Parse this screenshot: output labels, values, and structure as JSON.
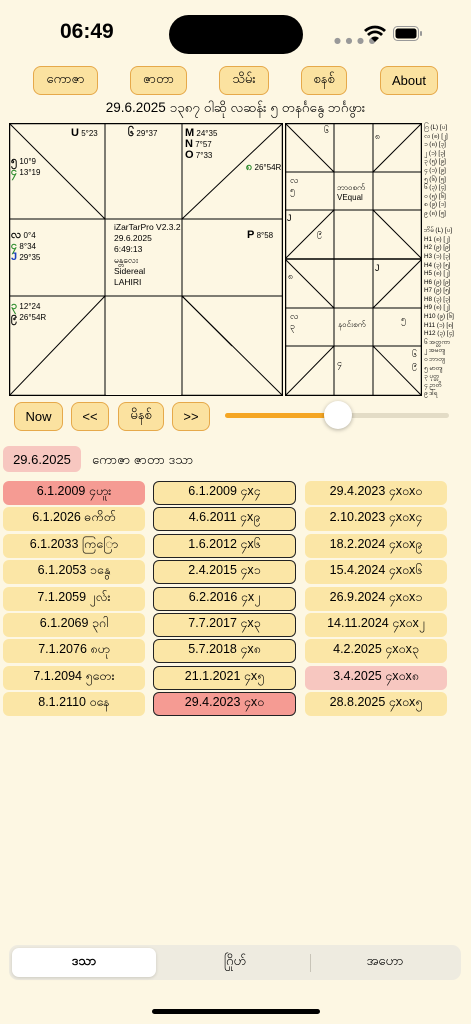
{
  "status_bar": {
    "time": "06:49"
  },
  "top_tabs": [
    "ကောဇာ",
    "ဇာတာ",
    "သိမ်း",
    "စနစ်",
    "About"
  ],
  "header_line": "29.6.2025  ၁၃၈၇ ဝါဆို  လဆန်း ၅ တနင်္ဂနွေ  ဘင်္ဂဖွား",
  "south_chart": {
    "cells": {
      "top_left": [
        {
          "sym": "U",
          "deg": "5°23"
        }
      ],
      "top_mid": [
        {
          "sym": "၆",
          "deg": "29°37"
        }
      ],
      "top_right": [
        {
          "sym": "M",
          "deg": "24°35"
        },
        {
          "sym": "N",
          "deg": "7°57"
        },
        {
          "sym": "O",
          "deg": "7°33"
        }
      ],
      "right_upper_tri": [
        {
          "sym": "၈",
          "deg": "26°54R"
        }
      ],
      "left_upper": [
        {
          "sym": "၅",
          "deg": "10°9"
        },
        {
          "sym": "၄",
          "deg": "13°19"
        }
      ],
      "left_mid": [
        {
          "sym": "လ",
          "deg": "0°4"
        },
        {
          "sym": "၄",
          "deg": "8°34"
        },
        {
          "sym": "J",
          "deg": "29°35"
        }
      ],
      "right_mid": [
        {
          "sym": "P",
          "deg": "8°58"
        }
      ],
      "left_lower": [
        {
          "sym": "၃",
          "deg": "12°24"
        },
        {
          "sym": "၉",
          "deg": "26°54R"
        }
      ]
    },
    "center_info": [
      "iZarTarPro V2.3.2",
      "29.6.2025",
      "6:49:13",
      "မန္တလေး",
      "Sidereal",
      "LAHIRI"
    ]
  },
  "grid_chart": {
    "cells": [
      "၆",
      "၈",
      "လ\n၅",
      "ဘာဝစက်\nVEqual",
      "J",
      "၉",
      "၈",
      "J",
      "လ\n၃",
      "နဝင်းစက်",
      "၅",
      "၄",
      "၆\n၉"
    ]
  },
  "side_list": [
    "ဂြ (L) [ပ]",
    "လ (၈) [၂]",
    "၁ (၈) [၃]",
    "၂ (၁) [၃]",
    "၃ (၅) [၉]",
    "၄ (၁) [၉]",
    "၅ (၆) [၅]",
    "၆ (၃) [၄]",
    "၀ (၅) [၆]",
    "၈ (၉) [၁]",
    "၉ (၈) [၅]",
    "",
    "ဘိမ် (L) [ပ]",
    "H1 (၈) [၂]",
    "H2 (၉) [၉]",
    "H3 (၁) [၃]",
    "H4 (၃) [၅]",
    "H5 (၈) [၂]",
    "H6 (၉) [၉]",
    "H7 (၉) [၅]",
    "H8 (၃) [၃]",
    "H9 (၈) [၂]",
    "H10 (၉) [၆]",
    "H11 (၁) [၈]",
    "H12 (၃) [၄]",
    "၆ အတ္တကာ",
    "၂ အမတျ",
    "၀ ဘာတျ",
    "၅ မာတျ",
    "၃ ပုတ္တ",
    "၄ ဉာတိ",
    "၉ ဒါရ"
  ],
  "nav_buttons": [
    "Now",
    "<<",
    "မိနစ်",
    ">>"
  ],
  "slider": {
    "value": 0.5
  },
  "date_badge": "29.6.2025",
  "section_title": "ကောဇာ ဇာတာ ဒသာ",
  "dasa_table": {
    "col1": [
      "6.1.2009 ၄ဟူး",
      "6.1.2026 ဓကိတ်",
      "6.1.2033 ကြြော",
      "6.1.2053 ၁နွေ",
      "7.1.2059 ၂လ်း",
      "6.1.2069 ၃ဂါ",
      "7.1.2076 ၈ဟု",
      "7.1.2094 ၅တေး",
      "8.1.2110 ဝနေ"
    ],
    "col2": [
      "6.1.2009 ၄x၄",
      "4.6.2011 ၄x၉",
      "1.6.2012 ၄x၆",
      "2.4.2015 ၄x၁",
      "6.2.2016 ၄x၂",
      "7.7.2017 ၄x၃",
      "5.7.2018 ၄x၈",
      "21.1.2021 ၄x၅",
      "29.4.2023 ၄x၀"
    ],
    "col3": [
      "29.4.2023 ၄x၀x၀",
      "2.10.2023 ၄x၀x၄",
      "18.2.2024 ၄x၀x၉",
      "15.4.2024 ၄x၀x၆",
      "26.9.2024 ၄x၀x၁",
      "14.11.2024 ၄x၀x၂",
      "4.2.2025 ၄x၀x၃",
      "3.4.2025 ၄x၀x၈",
      "28.8.2025 ၄x၀x၅"
    ],
    "highlight": {
      "col1_row": 0,
      "col2_row": 8,
      "col3_row": 7
    }
  },
  "bottom_tabs": [
    "ဒသာ",
    "ဂြိုဟ်",
    "အဟော"
  ],
  "colors": {
    "background": "#fdf7e3",
    "button": "#fbe2a0",
    "button_border": "#e6a94a",
    "highlight": "#f59b93",
    "slider": "#f5a623"
  }
}
